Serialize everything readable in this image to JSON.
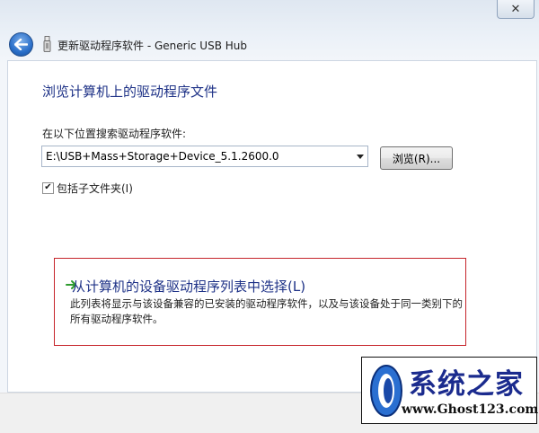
{
  "window": {
    "title": "更新驱动程序软件 - Generic USB Hub",
    "close_label": "✕"
  },
  "main": {
    "heading": "浏览计算机上的驱动程序文件",
    "search_label": "在以下位置搜索驱动程序软件:",
    "path_value": "E:\\USB+Mass+Storage+Device_5.1.2600.0",
    "browse_button": "浏览(R)...",
    "include_subfolders": {
      "label": "包括子文件夹(I)",
      "checked": true
    },
    "pick_option": {
      "title": "从计算机的设备驱动程序列表中选择(L)",
      "description": "此列表将显示与该设备兼容的已安装的驱动程序软件，以及与该设备处于同一类别下的所有驱动程序软件。"
    }
  },
  "watermark": {
    "title": "系统之家",
    "url": "www.Ghost123.com"
  },
  "colors": {
    "heading": "#1e3287",
    "highlight_border": "#c6252b",
    "arrow": "#2e9b2e"
  }
}
